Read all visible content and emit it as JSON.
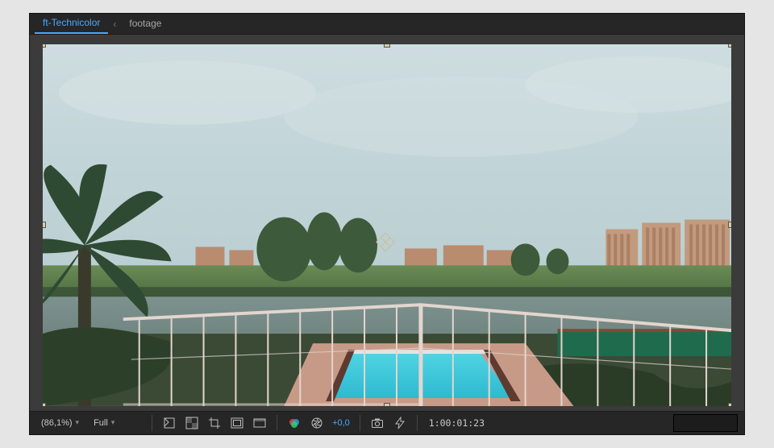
{
  "tabs": {
    "active": "ft-Technicolor",
    "crumb": "footage",
    "sep": "‹"
  },
  "toolbar": {
    "zoom": "(86,1%)",
    "resolution": "Full",
    "exposure": "+0,0",
    "timecode": "1:00:01:23"
  },
  "icons": {
    "mask_toggle": "mask-toggle",
    "transparency_grid": "transparency-grid",
    "roi": "region-of-interest",
    "safe_zones": "title-safe",
    "channel": "channels",
    "color_mgmt": "color-management",
    "aperture": "aperture",
    "snapshot": "snapshot",
    "preview_quality": "fast-previews"
  }
}
